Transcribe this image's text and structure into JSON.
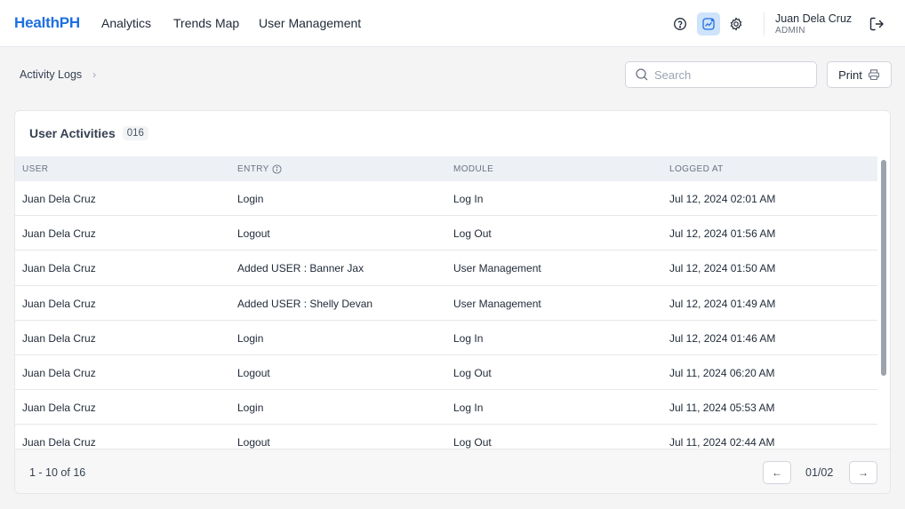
{
  "header": {
    "brand": "HealthPH",
    "nav": [
      {
        "label": "Analytics"
      },
      {
        "label": "Trends Map"
      },
      {
        "label": "User Management"
      }
    ],
    "user": {
      "name": "Juan Dela Cruz",
      "role": "ADMIN"
    },
    "icons": [
      "help-icon",
      "trend-chart-icon",
      "gear-icon",
      "logout-icon"
    ],
    "accent": "#1d6fe0"
  },
  "toolbar": {
    "breadcrumb": "Activity Logs",
    "search_placeholder": "Search",
    "print_label": "Print"
  },
  "card": {
    "title": "User Activities",
    "count": "016",
    "columns": [
      "USER",
      "ENTRY",
      "MODULE",
      "LOGGED AT"
    ],
    "rows": [
      [
        "Juan Dela Cruz",
        "Login",
        "Log In",
        "Jul 12, 2024 02:01 AM"
      ],
      [
        "Juan Dela Cruz",
        "Logout",
        "Log Out",
        "Jul 12, 2024 01:56 AM"
      ],
      [
        "Juan Dela Cruz",
        "Added USER : Banner Jax",
        "User Management",
        "Jul 12, 2024 01:50 AM"
      ],
      [
        "Juan Dela Cruz",
        "Added USER : Shelly Devan",
        "User Management",
        "Jul 12, 2024 01:49 AM"
      ],
      [
        "Juan Dela Cruz",
        "Login",
        "Log In",
        "Jul 12, 2024 01:46 AM"
      ],
      [
        "Juan Dela Cruz",
        "Logout",
        "Log Out",
        "Jul 11, 2024 06:20 AM"
      ],
      [
        "Juan Dela Cruz",
        "Login",
        "Log In",
        "Jul 11, 2024 05:53 AM"
      ],
      [
        "Juan Dela Cruz",
        "Logout",
        "Log Out",
        "Jul 11, 2024 02:44 AM"
      ]
    ]
  },
  "pagination": {
    "range": "1 - 10 of 16",
    "page": "01/02"
  }
}
